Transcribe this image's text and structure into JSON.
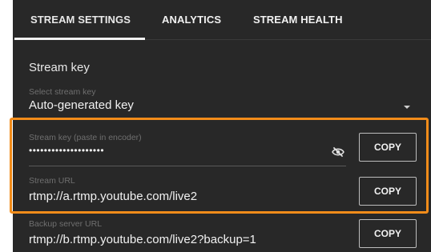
{
  "tabs": [
    {
      "label": "STREAM SETTINGS",
      "active": true
    },
    {
      "label": "ANALYTICS",
      "active": false
    },
    {
      "label": "STREAM HEALTH",
      "active": false
    }
  ],
  "section_title": "Stream key",
  "select_key": {
    "label": "Select stream key",
    "value": "Auto-generated key"
  },
  "stream_key": {
    "label": "Stream key (paste in encoder)",
    "value": "••••••••••••••••••••",
    "visibility_icon": "eye-off-icon",
    "copy_label": "COPY"
  },
  "stream_url": {
    "label": "Stream URL",
    "value": "rtmp://a.rtmp.youtube.com/live2",
    "copy_label": "COPY"
  },
  "backup_url": {
    "label": "Backup server URL",
    "value": "rtmp://b.rtmp.youtube.com/live2?backup=1",
    "copy_label": "COPY"
  },
  "colors": {
    "panel_bg": "#282828",
    "highlight": "#f28c1a",
    "text": "#f1f1f1",
    "muted": "#6f6f6f"
  }
}
